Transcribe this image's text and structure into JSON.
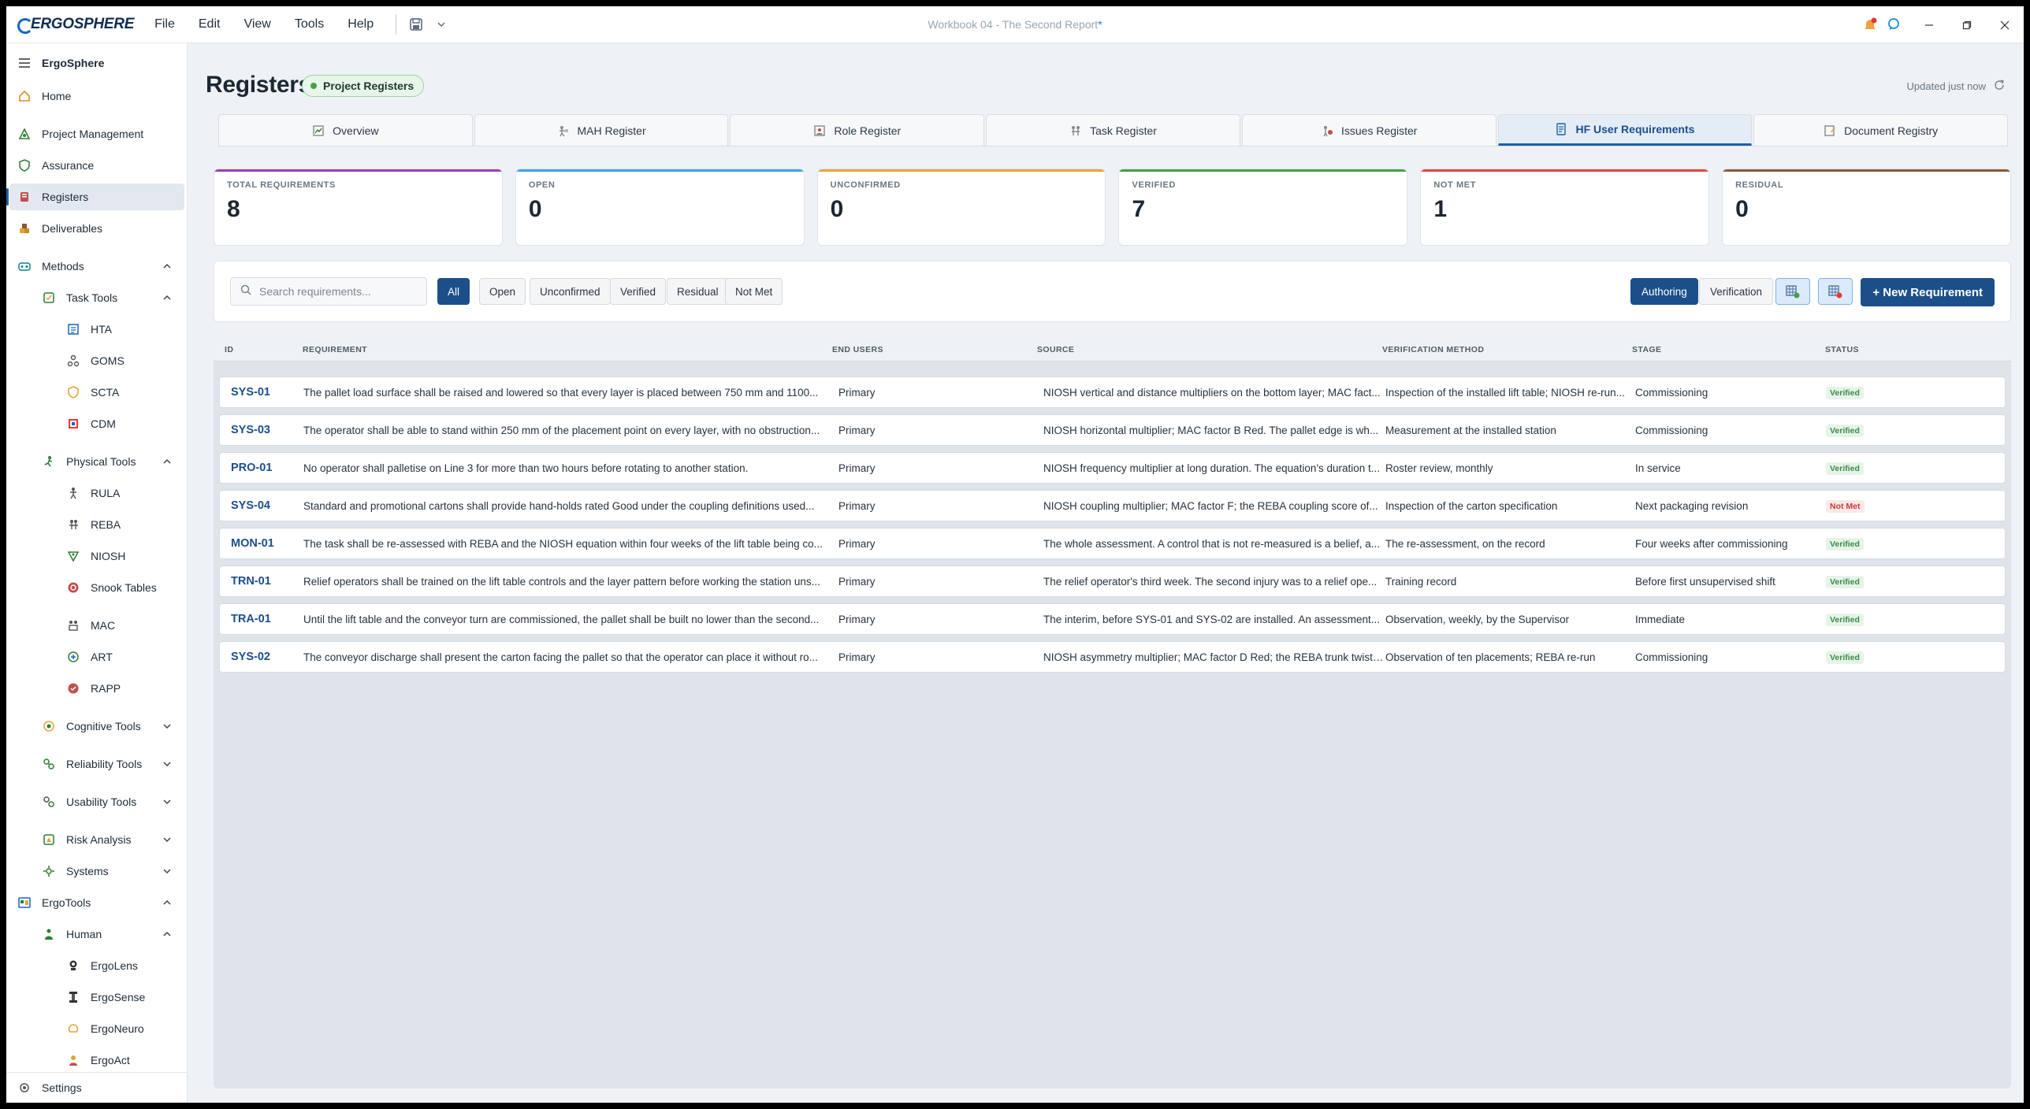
{
  "app": {
    "brand": "ERGOSPHERE",
    "window_title": "Workbook 04 - The Second Report",
    "dirty_marker": "*",
    "menu": [
      "File",
      "Edit",
      "View",
      "Tools",
      "Help"
    ],
    "colors": {
      "primary": "#1c4f8a",
      "accent": "#1f5fa8"
    }
  },
  "sidebar": {
    "app_name": "ErgoSphere",
    "items": [
      {
        "label": "Home",
        "icon": "home-icon"
      },
      {
        "label": "Project Management",
        "icon": "project-management-icon"
      },
      {
        "label": "Assurance",
        "icon": "shield-icon"
      },
      {
        "label": "Registers",
        "icon": "book-icon",
        "active": true
      },
      {
        "label": "Deliverables",
        "icon": "boxes-icon"
      },
      {
        "label": "Methods",
        "icon": "methods-icon",
        "expanded": true
      },
      {
        "label": "Task Tools",
        "icon": "task-tools-icon",
        "expanded": true
      },
      {
        "label": "HTA",
        "icon": "hta-icon"
      },
      {
        "label": "GOMS",
        "icon": "goms-icon"
      },
      {
        "label": "SCTA",
        "icon": "scta-icon"
      },
      {
        "label": "CDM",
        "icon": "cdm-icon"
      },
      {
        "label": "Physical Tools",
        "icon": "physical-tools-icon",
        "expanded": true
      },
      {
        "label": "RULA",
        "icon": "rula-icon"
      },
      {
        "label": "REBA",
        "icon": "reba-icon"
      },
      {
        "label": "NIOSH",
        "icon": "niosh-icon"
      },
      {
        "label": "Snook Tables",
        "icon": "snook-icon"
      },
      {
        "label": "MAC",
        "icon": "mac-icon"
      },
      {
        "label": "ART",
        "icon": "art-icon"
      },
      {
        "label": "RAPP",
        "icon": "rapp-icon"
      },
      {
        "label": "Cognitive Tools",
        "icon": "cognitive-tools-icon",
        "expanded": false
      },
      {
        "label": "Reliability Tools",
        "icon": "reliability-tools-icon",
        "expanded": false
      },
      {
        "label": "Usability Tools",
        "icon": "usability-tools-icon",
        "expanded": false
      },
      {
        "label": "Risk Analysis",
        "icon": "risk-analysis-icon",
        "expanded": false
      },
      {
        "label": "Systems",
        "icon": "systems-icon",
        "expanded": false
      },
      {
        "label": "ErgoTools",
        "icon": "ergotools-icon",
        "expanded": true
      },
      {
        "label": "Human",
        "icon": "human-icon",
        "expanded": true
      },
      {
        "label": "ErgoLens",
        "icon": "ergolens-icon"
      },
      {
        "label": "ErgoSense",
        "icon": "ergosense-icon"
      },
      {
        "label": "ErgoNeuro",
        "icon": "ergoneuro-icon"
      },
      {
        "label": "ErgoAct",
        "icon": "ergoact-icon"
      }
    ],
    "settings_label": "Settings"
  },
  "header": {
    "title": "Registers",
    "project_badge": "Project Registers",
    "updated_text": "Updated just now"
  },
  "tabs": [
    {
      "label": "Overview",
      "icon": "overview-icon"
    },
    {
      "label": "MAH Register",
      "icon": "mah-icon"
    },
    {
      "label": "Role Register",
      "icon": "role-icon"
    },
    {
      "label": "Task Register",
      "icon": "task-icon"
    },
    {
      "label": "Issues Register",
      "icon": "issues-icon"
    },
    {
      "label": "HF User Requirements",
      "icon": "requirements-icon",
      "active": true
    },
    {
      "label": "Document Registry",
      "icon": "document-icon"
    }
  ],
  "stats": [
    {
      "label": "TOTAL REQUIREMENTS",
      "value": "8",
      "color": "#9c3fb4"
    },
    {
      "label": "OPEN",
      "value": "0",
      "color": "#3aa6dc"
    },
    {
      "label": "UNCONFIRMED",
      "value": "0",
      "color": "#f0a23a"
    },
    {
      "label": "VERIFIED",
      "value": "7",
      "color": "#43a047"
    },
    {
      "label": "NOT MET",
      "value": "1",
      "color": "#e04848"
    },
    {
      "label": "RESIDUAL",
      "value": "0",
      "color": "#8d5a3b"
    }
  ],
  "toolbar": {
    "search_placeholder": "Search requirements...",
    "filters": [
      "All",
      "Open",
      "Unconfirmed",
      "Verified",
      "Residual",
      "Not Met"
    ],
    "modes": [
      "Authoring",
      "Verification"
    ],
    "new_button": "+ New Requirement"
  },
  "table": {
    "headers": [
      "ID",
      "REQUIREMENT",
      "END USERS",
      "SOURCE",
      "VERIFICATION METHOD",
      "STAGE",
      "STATUS"
    ],
    "rows": [
      {
        "id": "SYS-01",
        "requirement": "The pallet load surface shall be raised and lowered so that every layer is placed between 750 mm and 1100...",
        "end_users": "Primary",
        "source": "NIOSH vertical and distance multipliers on the bottom layer; MAC fact...",
        "verification": "Inspection of the installed lift table; NIOSH re-run...",
        "stage": "Commissioning",
        "status": "Verified"
      },
      {
        "id": "SYS-03",
        "requirement": "The operator shall be able to stand within 250 mm of the placement point on every layer, with no obstruction...",
        "end_users": "Primary",
        "source": "NIOSH horizontal multiplier; MAC factor B Red. The pallet edge is wh...",
        "verification": "Measurement at the installed station",
        "stage": "Commissioning",
        "status": "Verified"
      },
      {
        "id": "PRO-01",
        "requirement": "No operator shall palletise on Line 3 for more than two hours before rotating to another station.",
        "end_users": "Primary",
        "source": "NIOSH frequency multiplier at long duration. The equation's duration t...",
        "verification": "Roster review, monthly",
        "stage": "In service",
        "status": "Verified"
      },
      {
        "id": "SYS-04",
        "requirement": "Standard and promotional cartons shall provide hand-holds rated Good under the coupling definitions used...",
        "end_users": "Primary",
        "source": "NIOSH coupling multiplier; MAC factor F; the REBA coupling score of...",
        "verification": "Inspection of the carton specification",
        "stage": "Next packaging revision",
        "status": "Not Met"
      },
      {
        "id": "MON-01",
        "requirement": "The task shall be re-assessed with REBA and the NIOSH equation within four weeks of the lift table being co...",
        "end_users": "Primary",
        "source": "The whole assessment. A control that is not re-measured is a belief, a...",
        "verification": "The re-assessment, on the record",
        "stage": "Four weeks after commissioning",
        "status": "Verified"
      },
      {
        "id": "TRN-01",
        "requirement": "Relief operators shall be trained on the lift table controls and the layer pattern before working the station uns...",
        "end_users": "Primary",
        "source": "The relief operator's third week. The second injury was to a relief ope...",
        "verification": "Training record",
        "stage": "Before first unsupervised shift",
        "status": "Verified"
      },
      {
        "id": "TRA-01",
        "requirement": "Until the lift table and the conveyor turn are commissioned, the pallet shall be built no lower than the second...",
        "end_users": "Primary",
        "source": "The interim, before SYS-01 and SYS-02 are installed. An assessment...",
        "verification": "Observation, weekly, by the Supervisor",
        "stage": "Immediate",
        "status": "Verified"
      },
      {
        "id": "SYS-02",
        "requirement": "The conveyor discharge shall present the carton facing the pallet so that the operator can place it without ro...",
        "end_users": "Primary",
        "source": "NIOSH asymmetry multiplier; MAC factor D Red; the REBA trunk twist....",
        "verification": "Observation of ten placements; REBA re-run",
        "stage": "Commissioning",
        "status": "Verified"
      }
    ]
  }
}
